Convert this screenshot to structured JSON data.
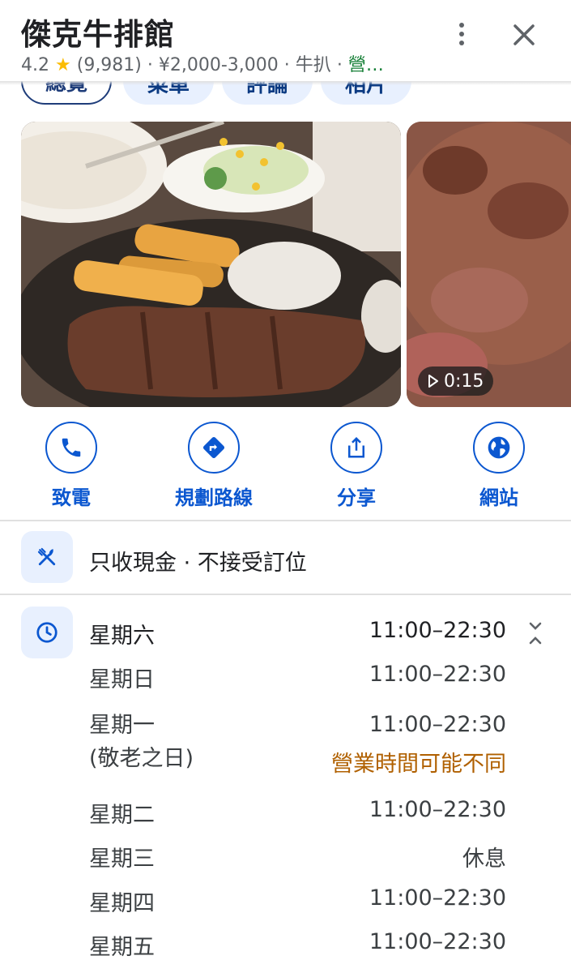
{
  "header": {
    "title": "傑克牛排館",
    "rating": "4.2",
    "star": "★",
    "reviews": "(9,981)",
    "price": "¥2,000-3,000",
    "category": "牛扒",
    "status": "營…",
    "separator": "·"
  },
  "tabs": [
    {
      "label": "總覽"
    },
    {
      "label": "菜單"
    },
    {
      "label": "評論"
    },
    {
      "label": "相片"
    }
  ],
  "media": {
    "video_duration": "0:15"
  },
  "actions": [
    {
      "label": "致電",
      "icon": "phone-icon"
    },
    {
      "label": "規劃路線",
      "icon": "directions-icon"
    },
    {
      "label": "分享",
      "icon": "share-icon"
    },
    {
      "label": "網站",
      "icon": "globe-icon"
    }
  ],
  "service_options": {
    "text": "只收現金 · 不接受訂位",
    "icon": "restaurant-icon"
  },
  "hours": {
    "icon": "clock-icon",
    "rows": [
      {
        "day": "星期六",
        "time": "11:00–22:30"
      },
      {
        "day": "星期日",
        "time": "11:00–22:30"
      },
      {
        "day": "星期一",
        "note": "(敬老之日)",
        "time": "11:00–22:30",
        "warning": "營業時間可能不同"
      },
      {
        "day": "星期二",
        "time": "11:00–22:30"
      },
      {
        "day": "星期三",
        "time": "休息"
      },
      {
        "day": "星期四",
        "time": "11:00–22:30"
      },
      {
        "day": "星期五",
        "time": "11:00–22:30"
      }
    ]
  },
  "colors": {
    "accent": "#0b57d0",
    "open_status": "#188038",
    "warning": "#b06000",
    "star": "#fbbc04"
  }
}
